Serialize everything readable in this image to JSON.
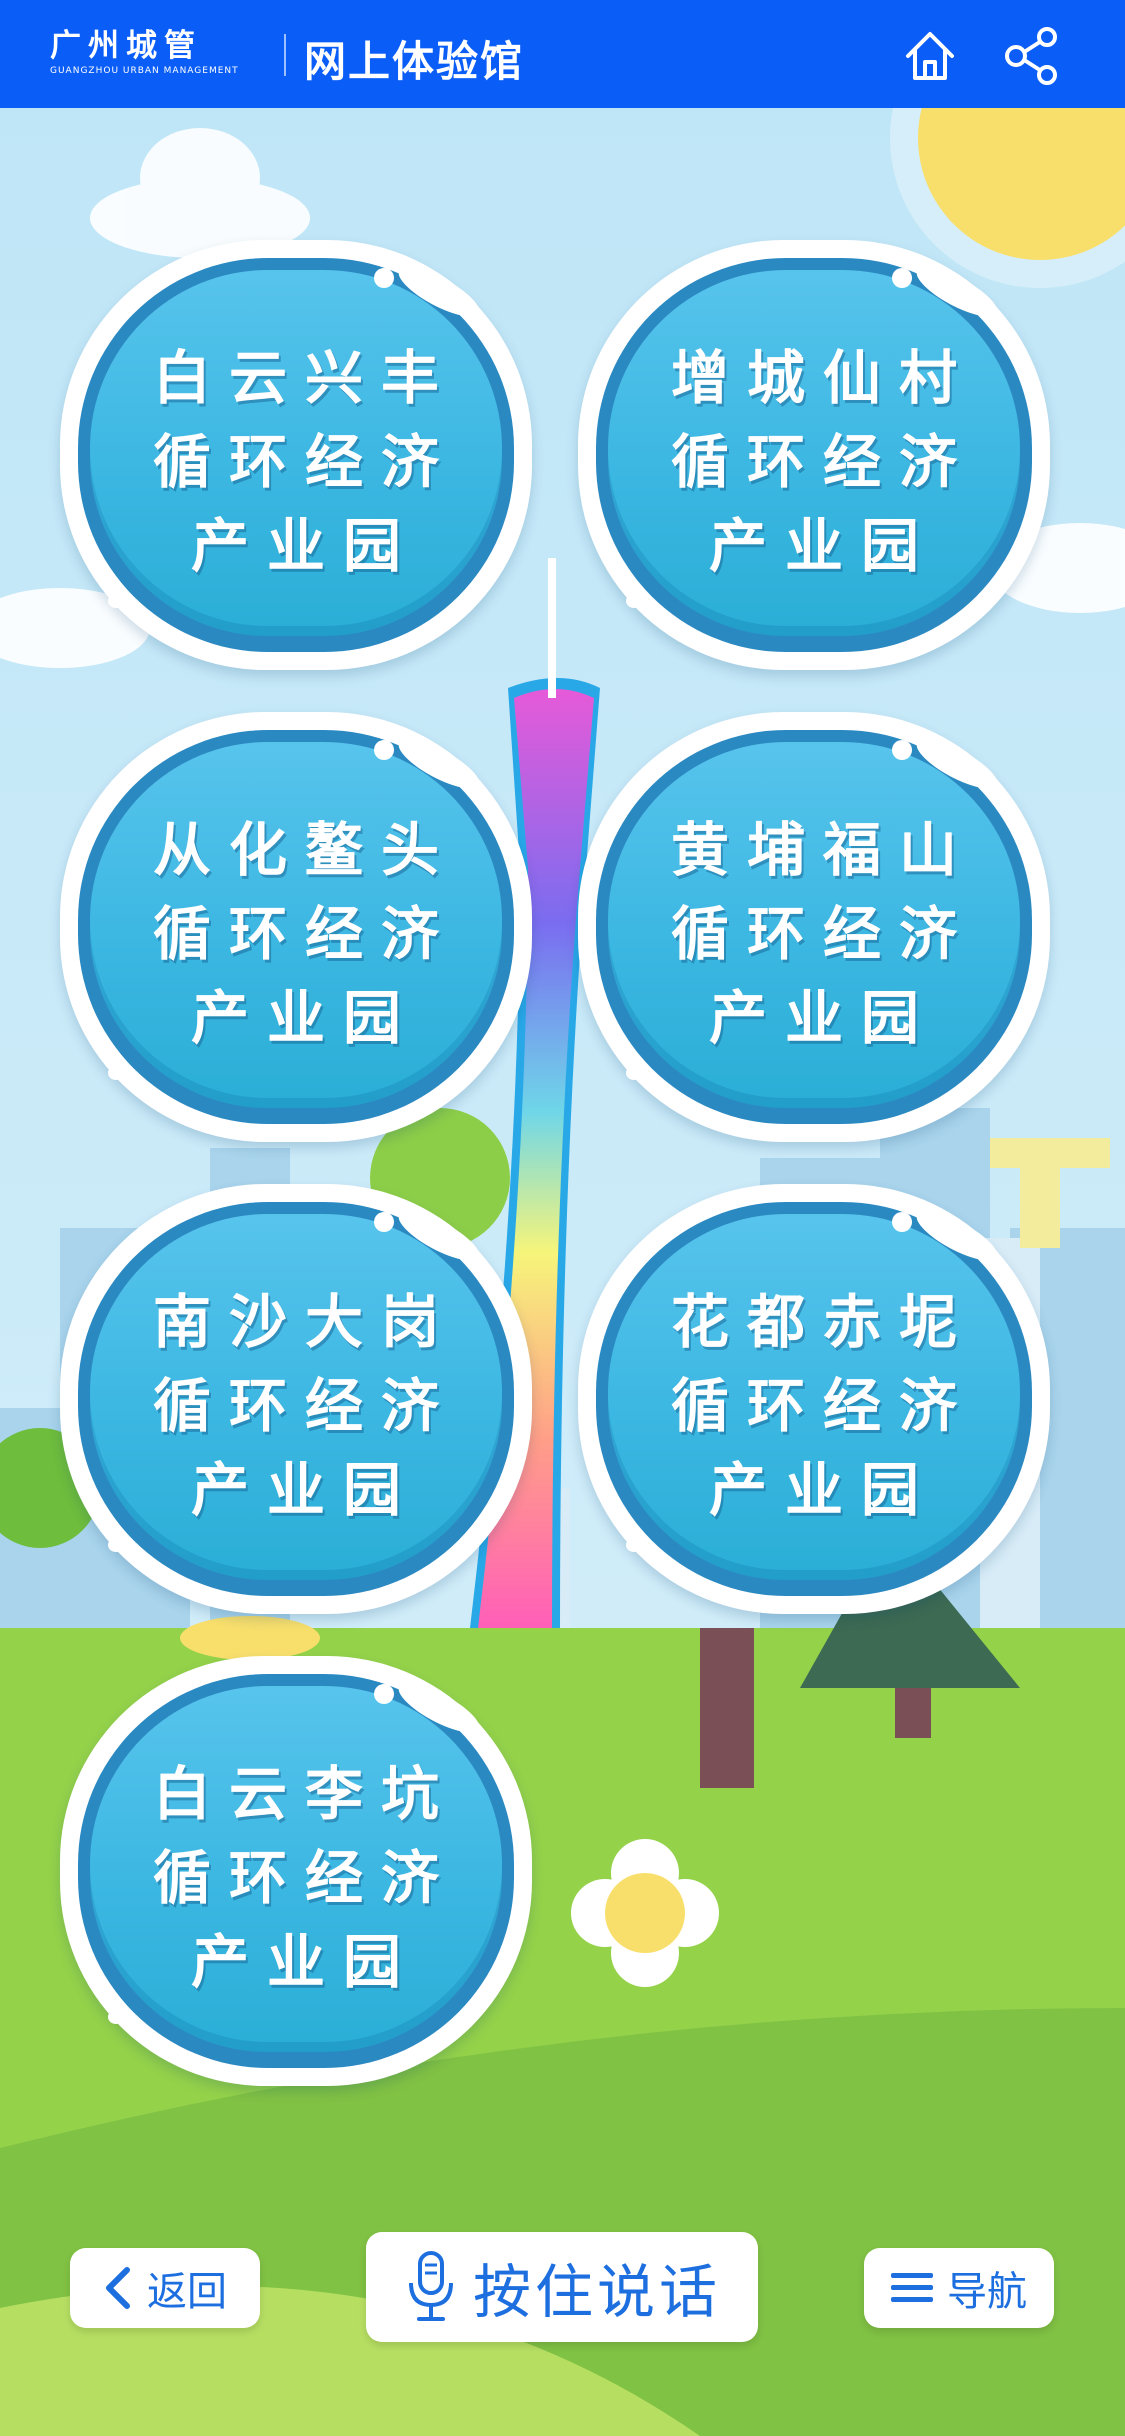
{
  "header": {
    "logo_cn": "广州城管",
    "logo_en": "GUANGZHOU URBAN MANAGEMENT",
    "title": "网上体验馆",
    "home_icon": "home-icon",
    "share_icon": "share-icon"
  },
  "parks": [
    {
      "line1": "白云兴丰",
      "line2": "循环经济",
      "line3": "产业园"
    },
    {
      "line1": "增城仙村",
      "line2": "循环经济",
      "line3": "产业园"
    },
    {
      "line1": "从化鳌头",
      "line2": "循环经济",
      "line3": "产业园"
    },
    {
      "line1": "黄埔福山",
      "line2": "循环经济",
      "line3": "产业园"
    },
    {
      "line1": "南沙大岗",
      "line2": "循环经济",
      "line3": "产业园"
    },
    {
      "line1": "花都赤坭",
      "line2": "循环经济",
      "line3": "产业园"
    },
    {
      "line1": "白云李坑",
      "line2": "循环经济",
      "line3": "产业园"
    }
  ],
  "bottom": {
    "back_label": "返回",
    "talk_label": "按住说话",
    "nav_label": "导航"
  },
  "colors": {
    "header": "#0a5ef7",
    "bubble": "#3bb7e2",
    "bubble_ring": "#2b89c2",
    "sky": "#bfe6f7",
    "grass": "#8ccd46",
    "button_text": "#1d6fe0"
  }
}
